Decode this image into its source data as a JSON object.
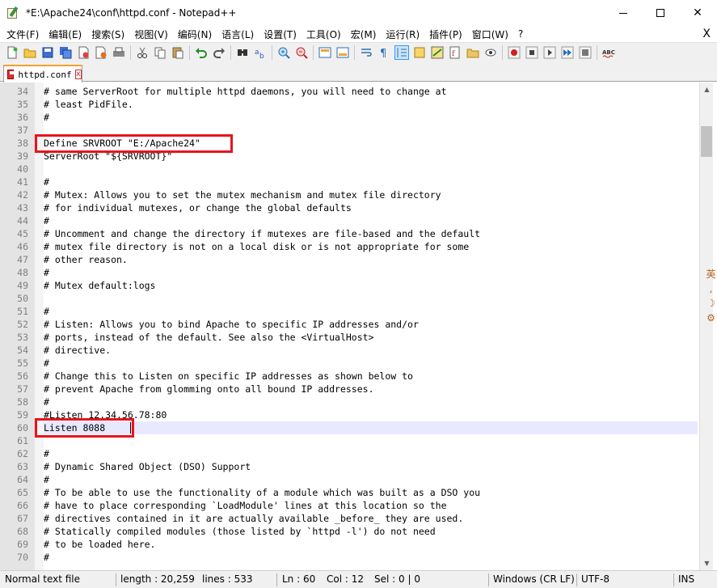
{
  "window": {
    "title": "*E:\\Apache24\\conf\\httpd.conf - Notepad++"
  },
  "menu": [
    "文件(F)",
    "编辑(E)",
    "搜索(S)",
    "视图(V)",
    "编码(N)",
    "语言(L)",
    "设置(T)",
    "工具(O)",
    "宏(M)",
    "运行(R)",
    "插件(P)",
    "窗口(W)",
    "?"
  ],
  "menu_close": "X",
  "tab": {
    "label": "httpd.conf",
    "close": "x"
  },
  "editor": {
    "current_line": 60,
    "lines": [
      {
        "n": "34",
        "text": "# same ServerRoot for multiple httpd daemons, you will need to change at"
      },
      {
        "n": "35",
        "text": "# least PidFile."
      },
      {
        "n": "36",
        "text": "#"
      },
      {
        "n": "37",
        "text": ""
      },
      {
        "n": "38",
        "text": "Define SRVROOT \"E:/Apache24\""
      },
      {
        "n": "39",
        "text": "ServerRoot \"${SRVROOT}\""
      },
      {
        "n": "40",
        "text": ""
      },
      {
        "n": "41",
        "text": "#"
      },
      {
        "n": "42",
        "text": "# Mutex: Allows you to set the mutex mechanism and mutex file directory"
      },
      {
        "n": "43",
        "text": "# for individual mutexes, or change the global defaults"
      },
      {
        "n": "44",
        "text": "#"
      },
      {
        "n": "45",
        "text": "# Uncomment and change the directory if mutexes are file-based and the default"
      },
      {
        "n": "46",
        "text": "# mutex file directory is not on a local disk or is not appropriate for some"
      },
      {
        "n": "47",
        "text": "# other reason."
      },
      {
        "n": "48",
        "text": "#"
      },
      {
        "n": "49",
        "text": "# Mutex default:logs"
      },
      {
        "n": "50",
        "text": ""
      },
      {
        "n": "51",
        "text": "#"
      },
      {
        "n": "52",
        "text": "# Listen: Allows you to bind Apache to specific IP addresses and/or"
      },
      {
        "n": "53",
        "text": "# ports, instead of the default. See also the <VirtualHost>"
      },
      {
        "n": "54",
        "text": "# directive."
      },
      {
        "n": "55",
        "text": "#"
      },
      {
        "n": "56",
        "text": "# Change this to Listen on specific IP addresses as shown below to"
      },
      {
        "n": "57",
        "text": "# prevent Apache from glomming onto all bound IP addresses."
      },
      {
        "n": "58",
        "text": "#"
      },
      {
        "n": "59",
        "text": "#Listen 12.34.56.78:80"
      },
      {
        "n": "60",
        "text": "Listen 8088"
      },
      {
        "n": "61",
        "text": ""
      },
      {
        "n": "62",
        "text": "#"
      },
      {
        "n": "63",
        "text": "# Dynamic Shared Object (DSO) Support"
      },
      {
        "n": "64",
        "text": "#"
      },
      {
        "n": "65",
        "text": "# To be able to use the functionality of a module which was built as a DSO you"
      },
      {
        "n": "66",
        "text": "# have to place corresponding `LoadModule' lines at this location so the"
      },
      {
        "n": "67",
        "text": "# directives contained in it are actually available _before_ they are used."
      },
      {
        "n": "68",
        "text": "# Statically compiled modules (those listed by `httpd -l') do not need"
      },
      {
        "n": "69",
        "text": "# to be loaded here."
      },
      {
        "n": "70",
        "text": "#"
      }
    ]
  },
  "ime_side": "英 , ☽ ⚙",
  "status": {
    "type": "Normal text file",
    "length": "length : 20,259",
    "lines": "lines : 533",
    "ln": "Ln : 60",
    "col": "Col : 12",
    "sel": "Sel : 0 | 0",
    "eol": "Windows (CR LF)",
    "encoding": "UTF-8",
    "mode": "INS"
  },
  "colors": {
    "highlight_box": "#e8141c",
    "current_line": "#e8e8ff",
    "gutter": "#e4e4e4",
    "tab_accent": "#f7a12b"
  }
}
